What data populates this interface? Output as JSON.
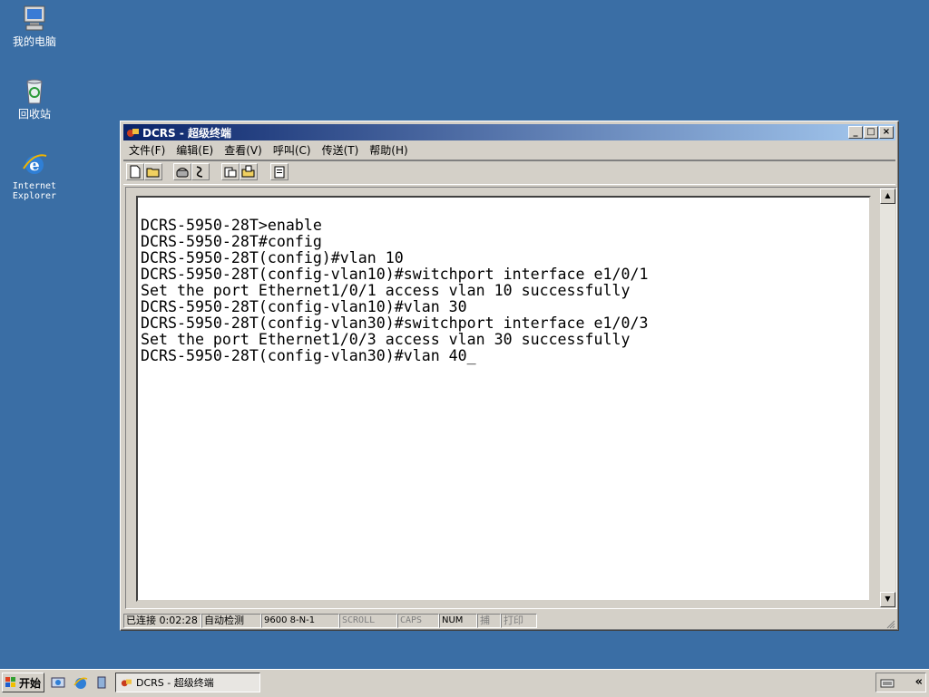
{
  "desktop": {
    "icons": [
      {
        "label": "我的电脑",
        "icon": "my-computer-icon"
      },
      {
        "label": "回收站",
        "icon": "recycle-bin-icon"
      },
      {
        "label": "Internet Explorer",
        "icon": "internet-explorer-icon"
      }
    ]
  },
  "window": {
    "title": "DCRS - 超级终端",
    "menu": [
      "文件(F)",
      "编辑(E)",
      "查看(V)",
      "呼叫(C)",
      "传送(T)",
      "帮助(H)"
    ],
    "toolbar_icons": [
      "new-file-icon",
      "open-folder-icon",
      "call-icon",
      "disconnect-icon",
      "send-icon",
      "receive-icon",
      "properties-icon"
    ],
    "terminal_lines": [
      "DCRS-5950-28T>enable",
      "DCRS-5950-28T#config",
      "DCRS-5950-28T(config)#vlan 10",
      "DCRS-5950-28T(config-vlan10)#switchport interface e1/0/1",
      "Set the port Ethernet1/0/1 access vlan 10 successfully",
      "DCRS-5950-28T(config-vlan10)#vlan 30",
      "DCRS-5950-28T(config-vlan30)#switchport interface e1/0/3",
      "Set the port Ethernet1/0/3 access vlan 30 successfully",
      "DCRS-5950-28T(config-vlan30)#vlan 40_"
    ],
    "status": {
      "connected": "已连接 0:02:28",
      "detect": "自动检测",
      "baud": "9600 8-N-1",
      "scroll": "SCROLL",
      "caps": "CAPS",
      "num": "NUM",
      "capture": "捕",
      "print": "打印"
    }
  },
  "taskbar": {
    "start_label": "开始",
    "task_label": "DCRS - 超级终端",
    "expand_label": "«"
  }
}
